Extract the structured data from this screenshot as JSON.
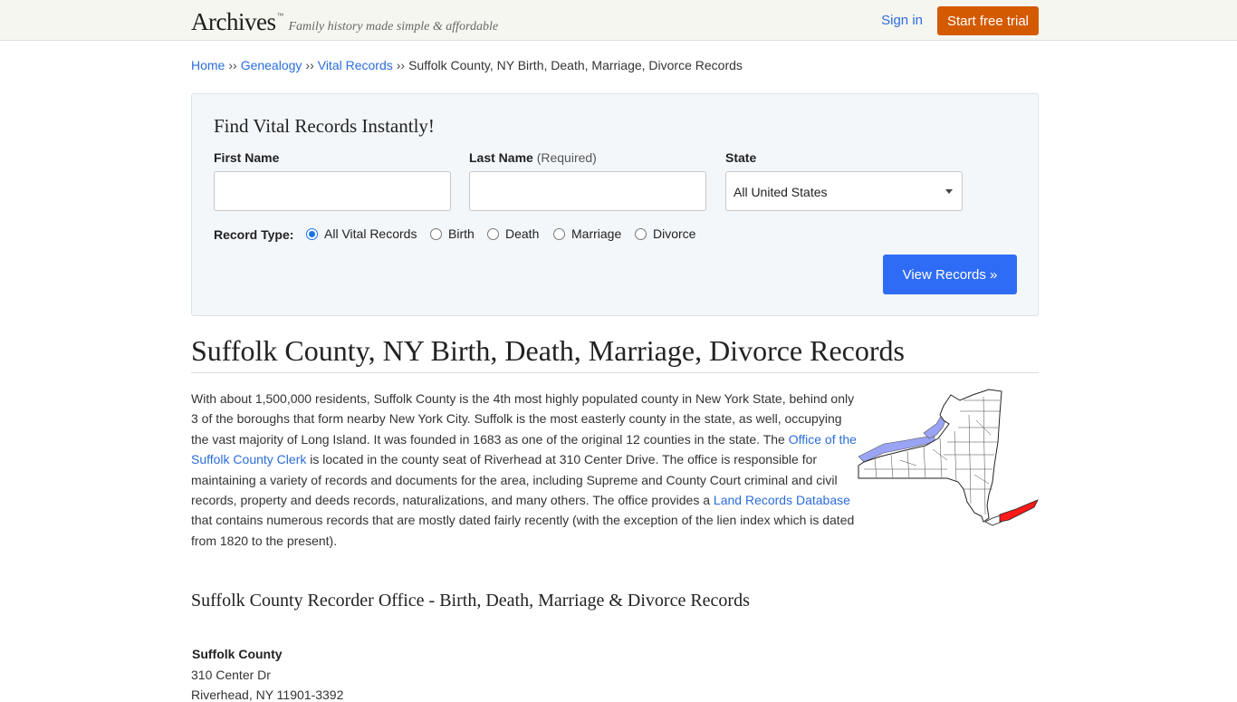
{
  "header": {
    "logo": "Archives",
    "logo_tm": "™",
    "tagline": "Family history made simple & affordable",
    "signin": "Sign in",
    "trial": "Start free trial"
  },
  "breadcrumb": {
    "items": [
      "Home",
      "Genealogy",
      "Vital Records"
    ],
    "separator": "››",
    "current": "Suffolk County, NY Birth, Death, Marriage, Divorce Records"
  },
  "search": {
    "title": "Find Vital Records Instantly!",
    "first_name_label": "First Name",
    "last_name_label": "Last Name",
    "last_name_required": "(Required)",
    "first_name_value": "",
    "last_name_value": "",
    "state_label": "State",
    "state_value": "All United States",
    "record_type_label": "Record Type:",
    "record_types": [
      {
        "label": "All Vital Records",
        "checked": true
      },
      {
        "label": "Birth",
        "checked": false
      },
      {
        "label": "Death",
        "checked": false
      },
      {
        "label": "Marriage",
        "checked": false
      },
      {
        "label": "Divorce",
        "checked": false
      }
    ],
    "submit": "View Records »"
  },
  "page": {
    "title": "Suffolk County, NY Birth, Death, Marriage, Divorce Records",
    "intro": {
      "p1": "With about 1,500,000 residents, Suffolk County is the 4th most highly populated county in New York State, behind only 3 of the boroughs that form nearby New York City. Suffolk is the most easterly county in the state, as well, occupying the vast majority of Long Island. It was founded in 1683 as one of the original 12 counties in the state. The ",
      "link1": "Office of the Suffolk County Clerk",
      "p2": " is located in the county seat of Riverhead at 310 Center Drive. The office is responsible for maintaining a variety of records and documents for the area, including Supreme and County Court criminal and civil records, property and deeds records, naturalizations, and many others. The office provides a ",
      "link2": "Land Records Database",
      "p3": " that contains numerous records that are mostly dated fairly recently (with the exception of the lien index which is dated from 1820 to the present)."
    },
    "section_title": "Suffolk County Recorder Office - Birth, Death, Marriage & Divorce Records",
    "office": {
      "name": "Suffolk County",
      "address1": "310 Center Dr",
      "address2": "Riverhead, NY 11901-3392"
    }
  },
  "colors": {
    "accent": "#2b6ddd",
    "trial_button": "#d45a00",
    "view_button": "#2f6cf6",
    "map_highlight": "#ff1a1a",
    "map_water": "#9aa4f5"
  }
}
